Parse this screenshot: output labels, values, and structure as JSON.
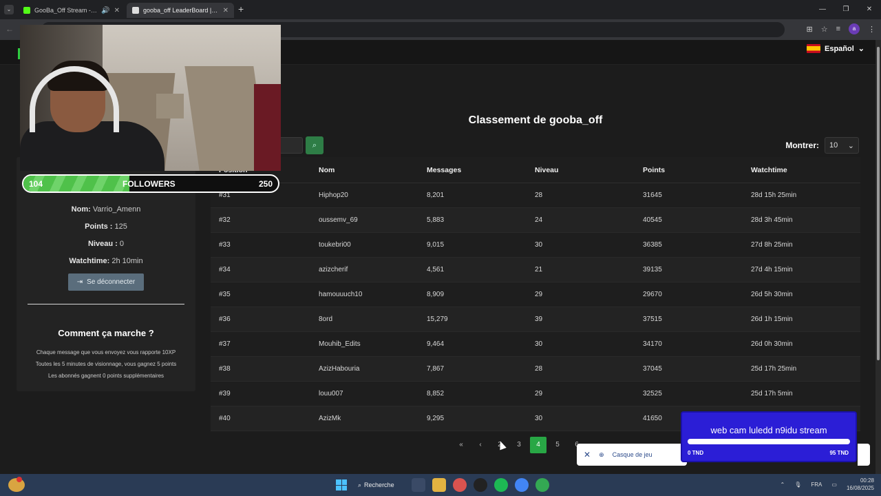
{
  "browser": {
    "tabs": [
      {
        "title": "GooBa_Off Stream - Watch",
        "icon_color": "#53fc18",
        "active": false
      },
      {
        "title": "gooba_off LeaderBoard | The be",
        "icon_color": "#dddddd",
        "active": true
      }
    ],
    "new_tab": "+",
    "window_controls": [
      "—",
      "❐",
      "✕"
    ]
  },
  "site": {
    "language": "Español",
    "board_title": "Classement de gooba_off",
    "show_label": "Montrer:",
    "show_value": "10"
  },
  "user": {
    "name_label": "Nom:",
    "name": "Varrio_Amenn",
    "points_label": "Points :",
    "points": "125",
    "level_label": "Niveau :",
    "level": "0",
    "watchtime_label": "Watchtime:",
    "watchtime": "2h 10min",
    "logout_label": "Se déconnecter"
  },
  "how": {
    "title": "Comment ça marche ?",
    "lines": [
      "Chaque message que vous envoyez vous rapporte 10XP",
      "Toutes les 5 minutes de visionnage, vous gagnez 5 points",
      "Les abonnés gagnent 0 points supplémentaires"
    ]
  },
  "table": {
    "headers": [
      "Position",
      "Nom",
      "Messages",
      "Niveau",
      "Points",
      "Watchtime"
    ],
    "rows": [
      [
        "#31",
        "Hiphop20",
        "8,201",
        "28",
        "31645",
        "28d 15h 25min"
      ],
      [
        "#32",
        "oussemv_69",
        "5,883",
        "24",
        "40545",
        "28d 3h 45min"
      ],
      [
        "#33",
        "toukebri00",
        "9,015",
        "30",
        "36385",
        "27d 8h 25min"
      ],
      [
        "#34",
        "azizcherif",
        "4,561",
        "21",
        "39135",
        "27d 4h 15min"
      ],
      [
        "#35",
        "hamouuuch10",
        "8,909",
        "29",
        "29670",
        "26d 5h 30min"
      ],
      [
        "#36",
        "8ord",
        "15,279",
        "39",
        "37515",
        "26d 1h 15min"
      ],
      [
        "#37",
        "Mouhib_Edits",
        "9,464",
        "30",
        "34170",
        "26d 0h 30min"
      ],
      [
        "#38",
        "AzizHabouria",
        "7,867",
        "28",
        "37045",
        "25d 17h 25min"
      ],
      [
        "#39",
        "louu007",
        "8,852",
        "29",
        "32525",
        "25d 17h 5min"
      ],
      [
        "#40",
        "AzizMk",
        "9,295",
        "30",
        "41650",
        ""
      ]
    ]
  },
  "pager": {
    "first": "«",
    "prev": "‹",
    "pages": [
      "2",
      "3",
      "4",
      "5",
      "6"
    ],
    "active": "4"
  },
  "overlay": {
    "followers_current": "104",
    "followers_label": "FOLLOWERS",
    "followers_target": "250",
    "followers_progress": 0.416,
    "goal_title": "web cam luledd n9idu stream",
    "goal_min": "0 TND",
    "goal_max": "95 TND",
    "toast_label": "Casque de jeu"
  },
  "taskbar": {
    "search_label": "Recherche",
    "lang": "FRA",
    "time": "00:28",
    "date": "16/08/2025"
  }
}
